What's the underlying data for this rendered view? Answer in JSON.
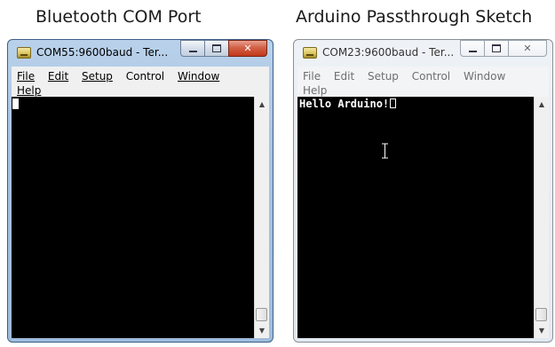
{
  "captions": {
    "left": "Bluetooth COM Port",
    "right": "Arduino Passthrough Sketch"
  },
  "windows": [
    {
      "title": "COM55:9600baud - Ter...",
      "state": "active",
      "menu_row1": [
        "File",
        "Edit",
        "Setup",
        "Control",
        "Window"
      ],
      "menu_row2": [
        "Help"
      ],
      "terminal_text": ""
    },
    {
      "title": "COM23:9600baud - Ter...",
      "state": "inactive",
      "menu_row1": [
        "File",
        "Edit",
        "Setup",
        "Control",
        "Window"
      ],
      "menu_row2": [
        "Help"
      ],
      "terminal_text": "Hello Arduino!"
    }
  ],
  "icons": {
    "app": "teraterm-app-icon",
    "minimize": "minimize-icon",
    "maximize": "maximize-icon",
    "close": "close-icon",
    "scroll_up": "scroll-up-arrow-icon",
    "scroll_down": "scroll-down-arrow-icon",
    "text_cursor": "i-beam-cursor-icon"
  },
  "colors": {
    "active_frame": "#a6c2e0",
    "inactive_frame": "#e3e9f0",
    "terminal_bg": "#000000",
    "terminal_fg": "#ffffff",
    "close_button": "#c2381a"
  }
}
